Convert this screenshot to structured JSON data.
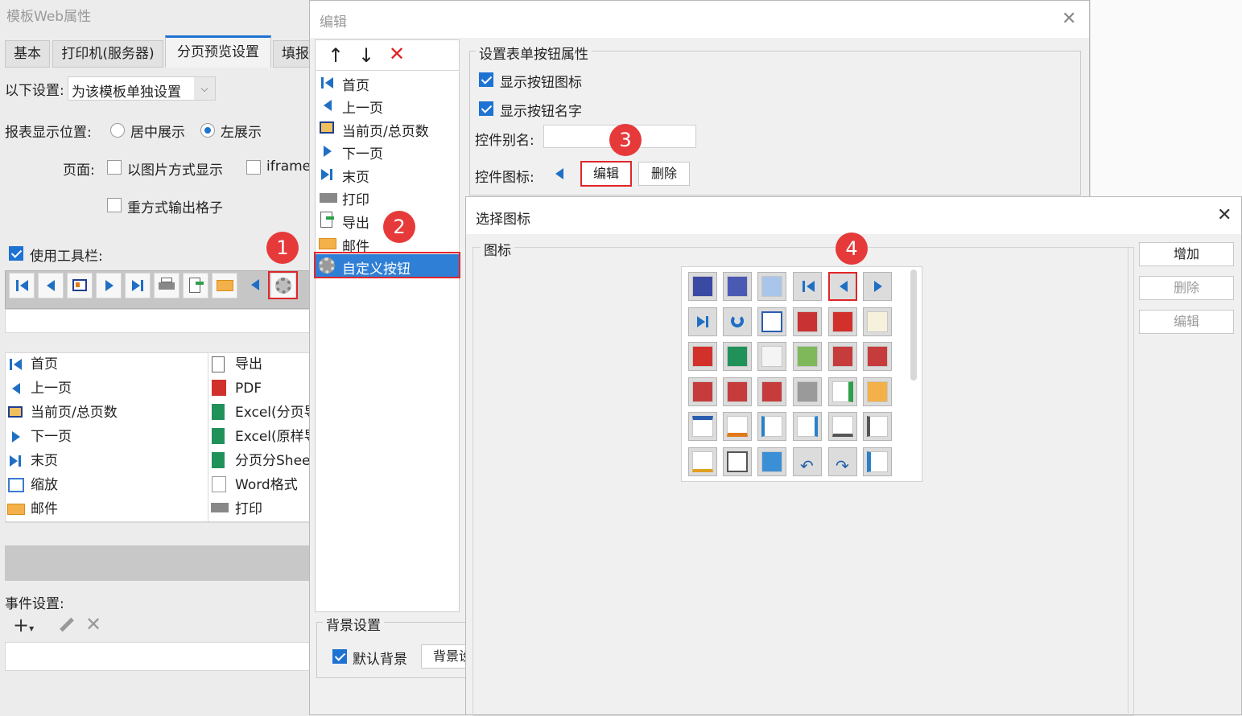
{
  "main_window": {
    "title": "模板Web属性",
    "tabs": [
      "基本",
      "打印机(服务器)",
      "分页预览设置",
      "填报"
    ],
    "settings_label": "以下设置:",
    "settings_value": "为该模板单独设置",
    "report_position_label": "报表显示位置:",
    "pos_center": "居中展示",
    "pos_left": "左展示",
    "page_label": "页面:",
    "page_image_option": "以图片方式显示",
    "page_iframe_option": "iframe",
    "output_grid_option": "重方式输出格子",
    "use_toolbar_label": "使用工具栏:",
    "button_list_left": [
      "首页",
      "上一页",
      "当前页/总页数",
      "下一页",
      "末页",
      "缩放",
      "邮件"
    ],
    "button_list_right": [
      "导出",
      "PDF",
      "Excel(分页导",
      "Excel(原样导",
      "分页分Shee",
      "Word格式",
      "打印"
    ],
    "event_label": "事件设置:"
  },
  "edit_dialog": {
    "title": "编辑",
    "tree_items": [
      "首页",
      "上一页",
      "当前页/总页数",
      "下一页",
      "末页",
      "打印",
      "导出",
      "邮件",
      "自定义按钮"
    ],
    "props_group": "设置表单按钮属性",
    "show_icon": "显示按钮图标",
    "show_name": "显示按钮名字",
    "alias_label": "控件别名:",
    "alias_value": "",
    "icon_label": "控件图标:",
    "edit_btn": "编辑",
    "delete_btn": "删除",
    "bg_group": "背景设置",
    "default_bg": "默认背景",
    "bg_btn": "背景设"
  },
  "icon_dialog": {
    "title": "选择图标",
    "group_label": "图标",
    "add_btn": "增加",
    "delete_btn": "删除",
    "edit_btn": "编辑"
  },
  "badges": [
    "1",
    "2",
    "3",
    "4"
  ],
  "colors": {
    "accent": "#1e73d2",
    "highlight": "#e0262a",
    "selected_row": "#2f7fd6"
  }
}
